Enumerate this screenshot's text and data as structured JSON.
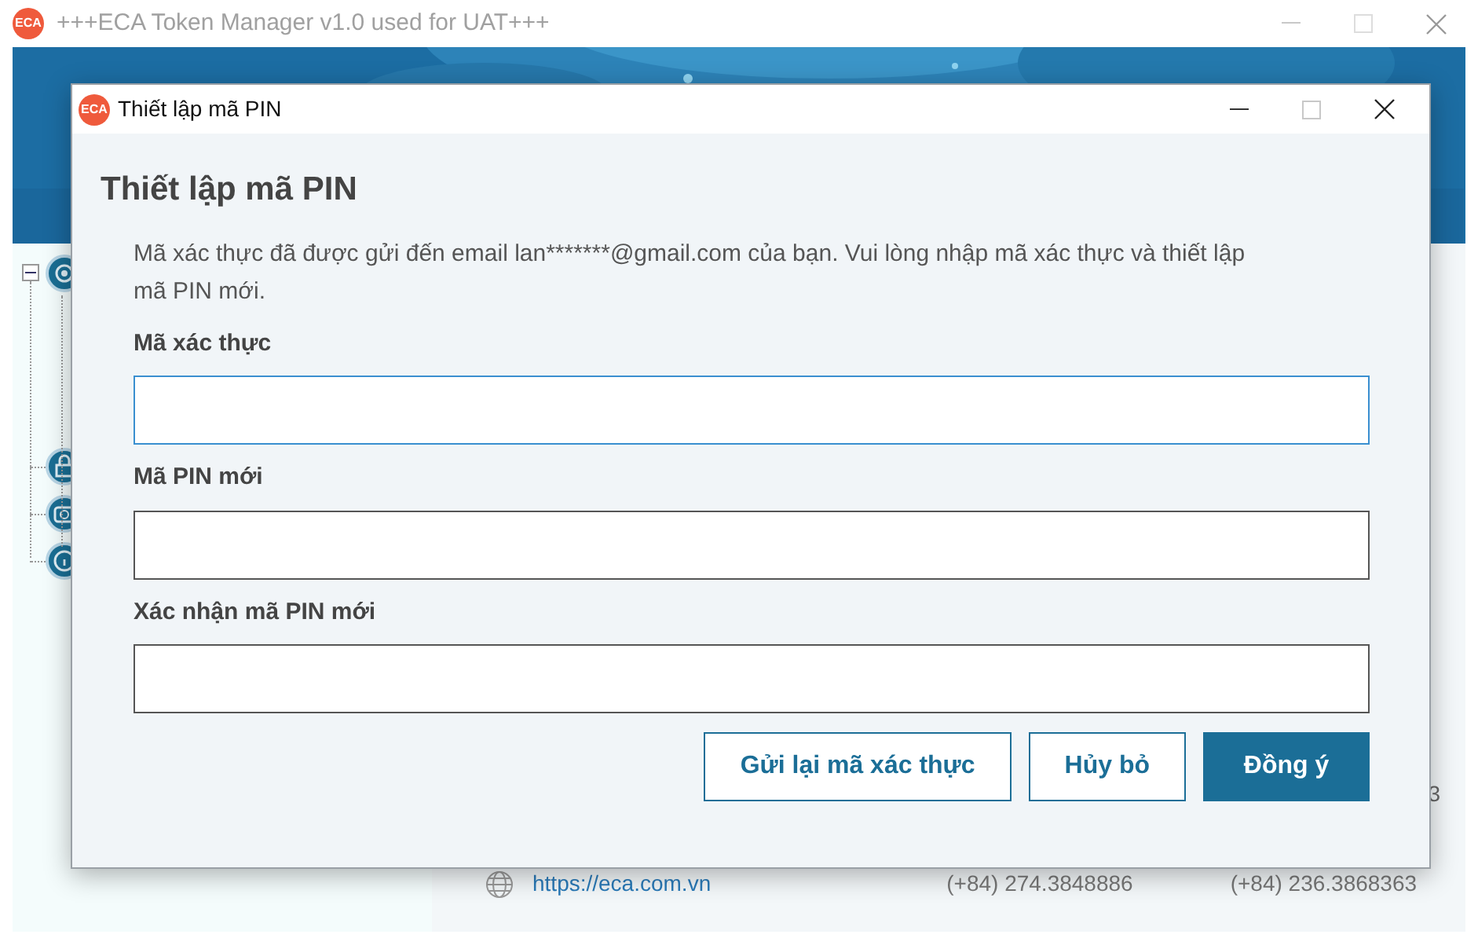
{
  "main_window": {
    "logo": "ECA",
    "title": "+++ECA Token Manager v1.0 used for UAT+++"
  },
  "tree": {
    "expanded": true,
    "nodes": [
      {
        "kind": "settings"
      },
      {
        "kind": "lock"
      },
      {
        "kind": "camera"
      },
      {
        "kind": "info"
      }
    ]
  },
  "contact": {
    "website": "https://eca.com.vn",
    "phones": [
      "(+84) 274.3848886",
      "(+84) 236.3868363"
    ],
    "cut_text": "3"
  },
  "dialog": {
    "logo": "ECA",
    "title": "Thiết lập mã PIN",
    "heading": "Thiết lập mã PIN",
    "message": "Mã xác thực đã được gửi đến email lan*******@gmail.com của bạn. Vui lòng nhập mã xác thực và thiết lập mã PIN mới.",
    "fields": [
      {
        "label": "Mã xác thực",
        "focused": true
      },
      {
        "label": "Mã PIN mới",
        "focused": false
      },
      {
        "label": "Xác nhận mã PIN mới",
        "focused": false
      }
    ],
    "buttons": [
      {
        "label": "Gửi lại mã xác thực",
        "kind": "secondary"
      },
      {
        "label": "Hủy bỏ",
        "kind": "secondary"
      },
      {
        "label": "Đồng ý",
        "kind": "primary"
      }
    ]
  }
}
